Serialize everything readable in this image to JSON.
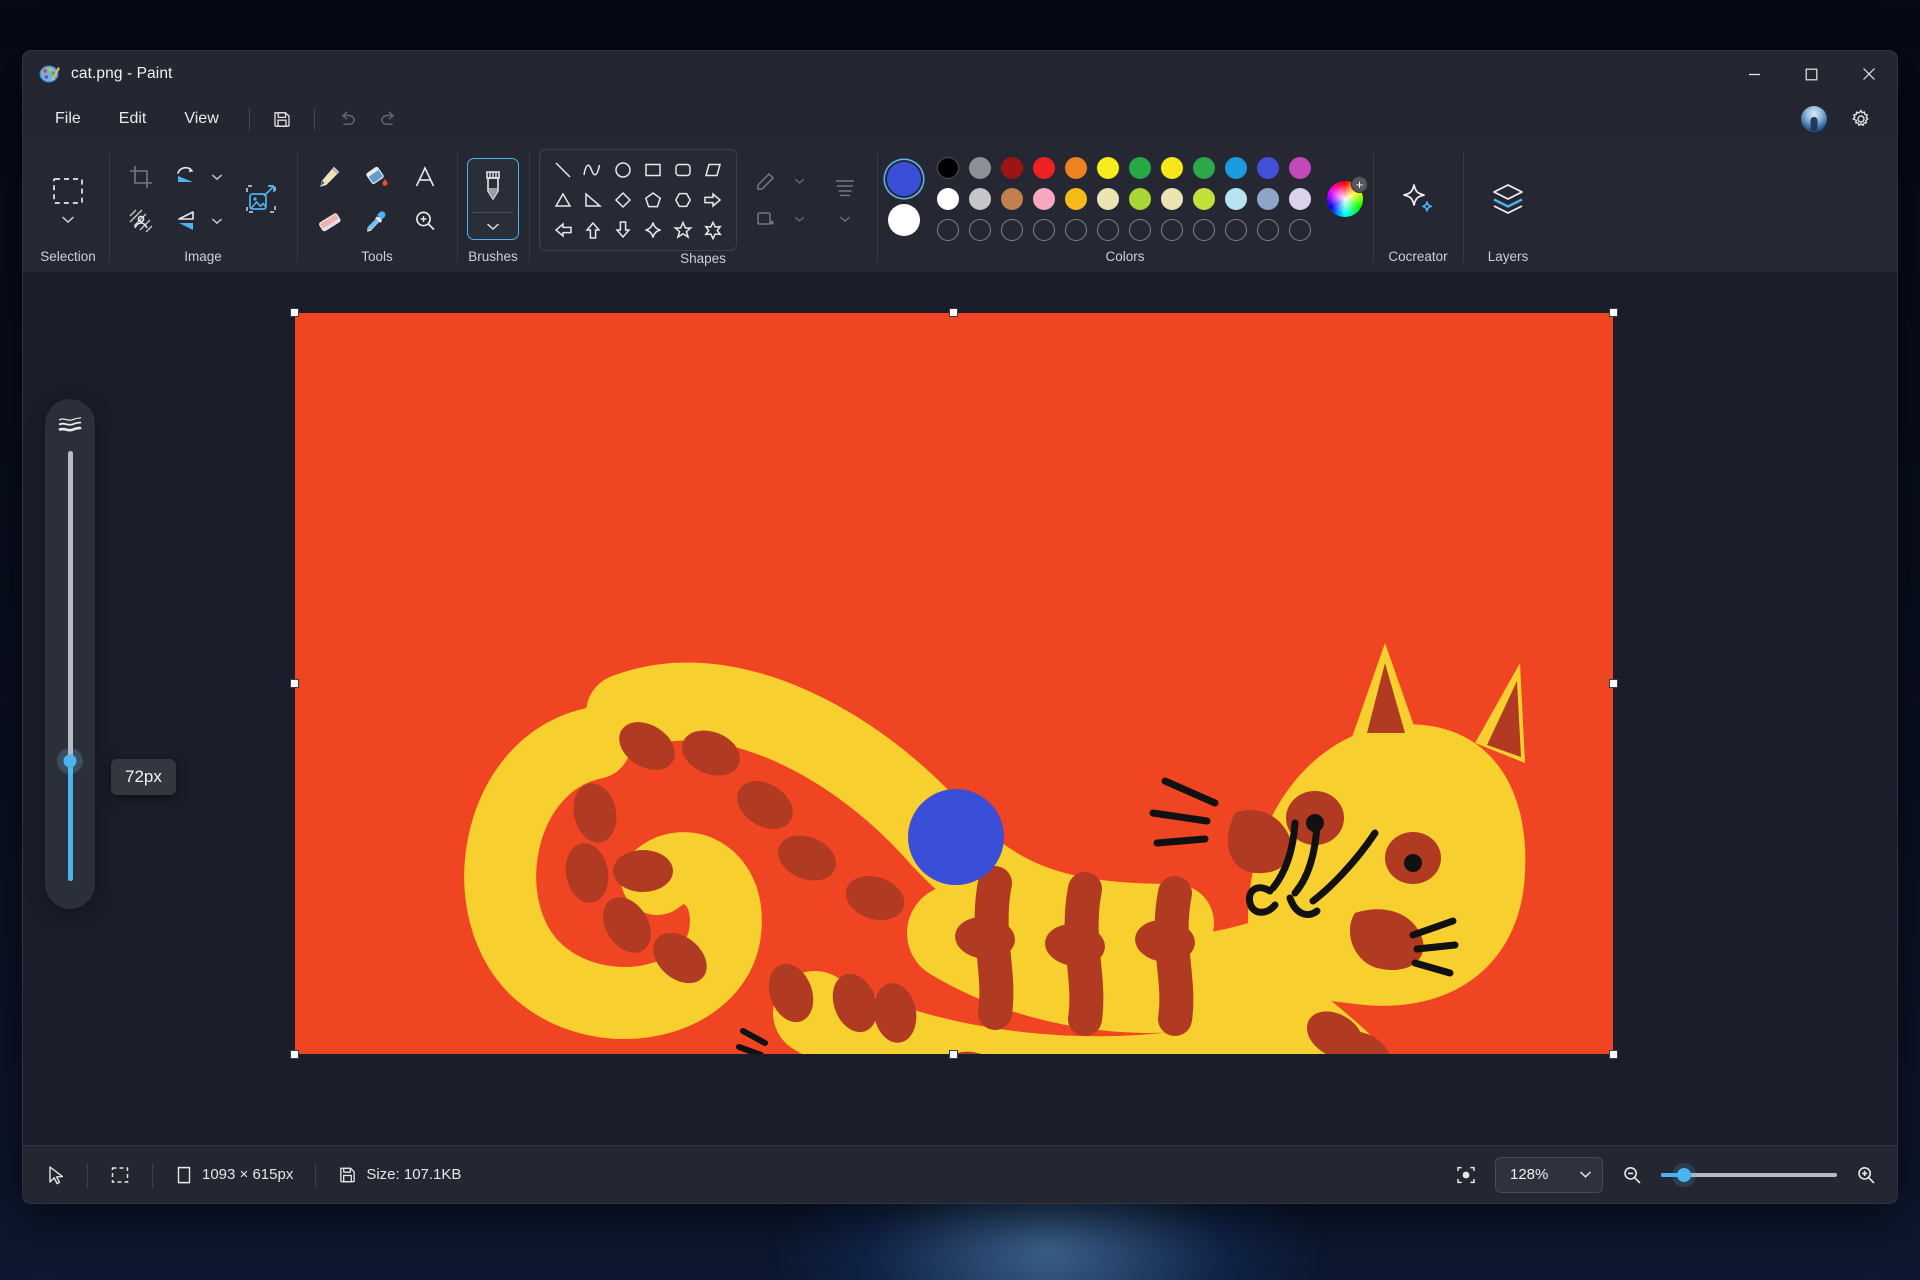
{
  "window": {
    "title": "cat.png - Paint",
    "app_icon": "paint-palette-icon",
    "controls": {
      "minimize": "—",
      "maximize": "□",
      "close": "✕"
    }
  },
  "menubar": {
    "items": [
      {
        "label": "File",
        "name": "menu-file"
      },
      {
        "label": "Edit",
        "name": "menu-edit"
      },
      {
        "label": "View",
        "name": "menu-view"
      }
    ],
    "quick_actions": [
      {
        "name": "save-button",
        "icon": "floppy-disk-icon",
        "enabled": true
      },
      {
        "name": "undo-button",
        "icon": "undo-arrow-icon",
        "enabled": false
      },
      {
        "name": "redo-button",
        "icon": "redo-arrow-icon",
        "enabled": false
      }
    ],
    "right": [
      {
        "name": "account-avatar",
        "icon": "avatar-icon"
      },
      {
        "name": "settings-button",
        "icon": "gear-icon"
      }
    ]
  },
  "ribbon": {
    "groups": [
      {
        "label": "Selection",
        "name": "group-selection"
      },
      {
        "label": "Image",
        "name": "group-image"
      },
      {
        "label": "Tools",
        "name": "group-tools"
      },
      {
        "label": "Brushes",
        "name": "group-brushes"
      },
      {
        "label": "Shapes",
        "name": "group-shapes"
      },
      {
        "label": "Colors",
        "name": "group-colors"
      },
      {
        "label": "Cocreator",
        "name": "group-cocreator"
      },
      {
        "label": "Layers",
        "name": "group-layers"
      }
    ],
    "selection": {
      "icon": "rectangular-selection-icon"
    },
    "image": {
      "crop": "crop-icon",
      "rotate": "rotate-icon",
      "remove_background": "remove-background-icon",
      "flip": "flip-icon",
      "resize": "resize-image-icon"
    },
    "tools": [
      {
        "name": "pencil-tool",
        "icon": "pencil-icon"
      },
      {
        "name": "fill-tool",
        "icon": "paint-bucket-icon"
      },
      {
        "name": "text-tool",
        "icon": "text-a-icon"
      },
      {
        "name": "eraser-tool",
        "icon": "eraser-icon"
      },
      {
        "name": "eyedropper-tool",
        "icon": "eyedropper-icon"
      },
      {
        "name": "magnifier-tool",
        "icon": "magnifier-icon"
      }
    ],
    "brushes": {
      "icon": "marker-brush-icon",
      "selected": true
    },
    "shapes": {
      "items": [
        "line-shape",
        "curve-shape",
        "oval-shape",
        "rectangle-shape",
        "rounded-rectangle-shape",
        "parallelogram-shape",
        "triangle-shape",
        "right-triangle-shape",
        "diamond-shape",
        "pentagon-shape",
        "hexagon-shape",
        "right-arrow-shape",
        "left-arrow-shape",
        "up-arrow-shape",
        "down-arrow-shape",
        "four-point-star-shape",
        "five-point-star-shape",
        "six-point-star-shape"
      ],
      "outline_button": "shape-outline-icon",
      "fill_button": "shape-fill-icon",
      "thickness_button": "shape-thickness-icon"
    },
    "colors": {
      "primary": "#3b4ed8",
      "secondary": "#ffffff",
      "row1": [
        "#000000",
        "#8d9096",
        "#9c1414",
        "#ee2222",
        "#f08224",
        "#f7ec1c",
        "#27a845",
        "#f4e81c",
        "#2aa84a",
        "#1b9ae0",
        "#4351d8",
        "#c14ab8"
      ],
      "row2": [
        "#ffffff",
        "#c4c6c9",
        "#c08050",
        "#f7a8bf",
        "#f5bb1a",
        "#ece3b4",
        "#a8d632",
        "#ece3b4",
        "#c1e03a",
        "#b7e4ee",
        "#8fa5c8",
        "#ddd2ee"
      ],
      "row3_empty_count": 12,
      "custom_color_button": "color-wheel-add-icon"
    },
    "cocreator": {
      "icon": "sparkle-icon"
    },
    "layers": {
      "icon": "layers-stack-icon"
    }
  },
  "brush_size_panel": {
    "icon": "brush-stroke-size-icon",
    "value_label": "72px",
    "fill_percent": 28
  },
  "canvas": {
    "background_color": "#f04523",
    "cat": {
      "body_color": "#f7cf2f",
      "stripe_color": "#b03a22",
      "line_color": "#111111"
    },
    "blue_dot_color": "#3b4ed8"
  },
  "statusbar": {
    "cursor_icon": "cursor-arrow-icon",
    "selection_icon": "selection-dashed-icon",
    "dimensions_icon": "image-size-icon",
    "dimensions": "1093 × 615px",
    "size_icon": "floppy-disk-icon",
    "file_size": "Size: 107.1KB",
    "fit_icon": "fit-to-window-icon",
    "zoom_level": "128%",
    "zoom_out_icon": "zoom-out-icon",
    "zoom_in_icon": "zoom-in-icon",
    "zoom_slider_percent": 13
  }
}
